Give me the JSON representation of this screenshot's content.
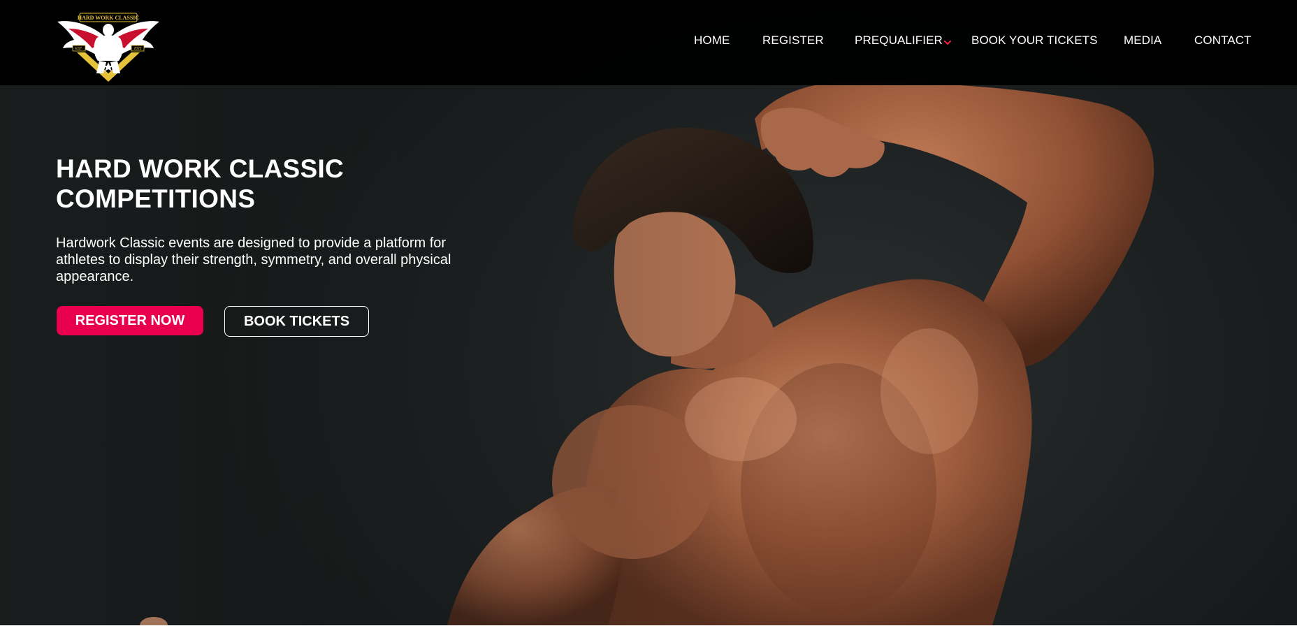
{
  "header": {
    "logo": {
      "icon": "hard-work-classic-logo",
      "wordmark": "HARD WORK CLASSIC",
      "est_left": "EST.",
      "est_right": "2022"
    },
    "nav": {
      "home": "HOME",
      "register": "REGISTER",
      "prequalifier": "PREQUALIFIER",
      "prequalifier_icon": "chevron-down-icon",
      "book_tickets": "BOOK YOUR TICKETS",
      "media": "MEDIA",
      "contact": "CONTACT"
    }
  },
  "hero": {
    "title_line1": "HARD WORK CLASSIC",
    "title_line2": "COMPETITIONS",
    "description": "Hardwork Classic events are designed to provide a platform for athletes to display their strength, symmetry, and overall physical appearance.",
    "register_button": "REGISTER NOW",
    "tickets_button": "BOOK TICKETS",
    "background_image": "bodybuilder-back-pose-photo"
  },
  "colors": {
    "header_bg": "#000000",
    "accent": "#e8004f",
    "chevron": "#e8193c",
    "text": "#ffffff",
    "hero_bg": "#1c2020"
  }
}
